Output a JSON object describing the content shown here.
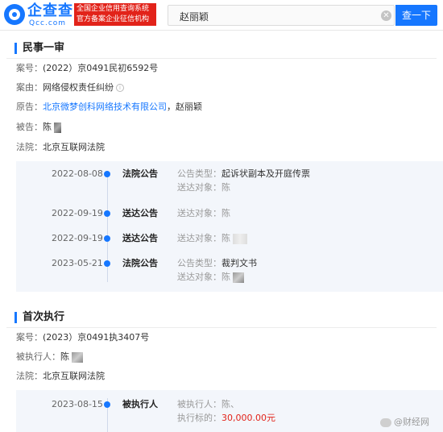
{
  "header": {
    "logo_name": "企查查",
    "logo_domain": "Qcc.com",
    "banner_line1": "全国企业信用查询系统",
    "banner_line2": "官方备案企业征信机构",
    "search_value": "赵丽颖",
    "search_button": "查一下"
  },
  "case1": {
    "title": "民事一审",
    "case_no_label": "案号：",
    "case_no": "(2022）京0491民初6592号",
    "cause_label": "案由：",
    "cause": "网络侵权责任纠纷",
    "plaintiff_label": "原告：",
    "plaintiff_company": "北京微梦创科网络技术有限公司",
    "plaintiff_sep": "，",
    "plaintiff_person": "赵丽颖",
    "defendant_label": "被告：",
    "defendant": "陈",
    "court_label": "法院：",
    "court": "北京互联网法院",
    "timeline": [
      {
        "date": "2022-08-08",
        "type": "法院公告",
        "k1": "公告类型：",
        "v1": "起诉状副本及开庭传票",
        "k2": "送达对象：",
        "v2": "陈"
      },
      {
        "date": "2022-09-19",
        "type": "送达公告",
        "k1": "送达对象：",
        "v1": "陈"
      },
      {
        "date": "2022-09-19",
        "type": "送达公告",
        "k1": "送达对象：",
        "v1": "陈"
      },
      {
        "date": "2023-05-21",
        "type": "法院公告",
        "k1": "公告类型：",
        "v1": "裁判文书",
        "k2": "送达对象：",
        "v2": "陈"
      }
    ]
  },
  "case2": {
    "title": "首次执行",
    "case_no_label": "案号：",
    "case_no": "(2023）京0491执3407号",
    "executed_label": "被执行人：",
    "executed": "陈",
    "court_label": "法院：",
    "court": "北京互联网法院",
    "timeline": [
      {
        "date": "2023-08-15",
        "type": "被执行人",
        "k1": "被执行人：",
        "v1": "陈、",
        "k2": "执行标的：",
        "v2": "30,000.00元"
      }
    ]
  },
  "watermark": "@财经网",
  "colors": {
    "accent": "#1677ff",
    "banner_red": "#e2231a",
    "amount_red": "#e2231a"
  }
}
